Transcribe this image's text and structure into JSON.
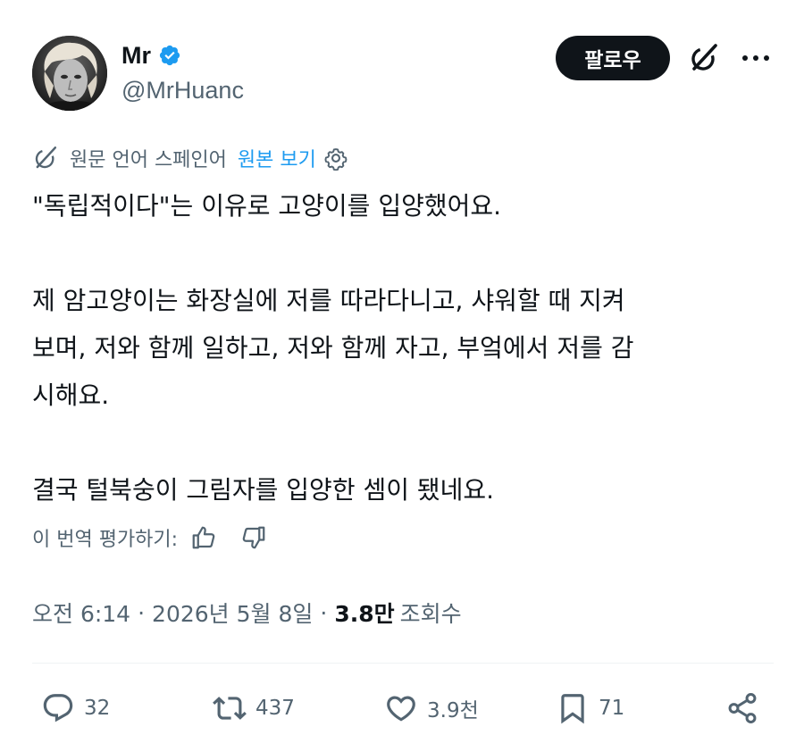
{
  "author": {
    "display_name": "Mr",
    "handle": "@MrHuanc",
    "verified": true,
    "avatar": "avatar-photo"
  },
  "header": {
    "follow_label": "팔로우",
    "grok_icon": "grok-icon",
    "more_icon": "more-icon"
  },
  "translation": {
    "icon": "grok-icon",
    "source_language": "원문 언어 스페인어",
    "show_original": "원본 보기",
    "settings_icon": "gear-icon"
  },
  "tweet": {
    "paragraph_1": "\"독립적이다\"는 이유로 고양이를 입양했어요.",
    "paragraph_2_line_1": "제 암고양이는 화장실에 저를 따라다니고, 샤워할 때 지켜",
    "paragraph_2_line_2": "보며, 저와 함께 일하고, 저와 함께 자고, 부엌에서 저를 감",
    "paragraph_2_line_3": "시해요.",
    "paragraph_3": "결국 털북숭이 그림자를 입양한 셈이 됐네요."
  },
  "rate": {
    "label": "이 번역 평가하기:",
    "thumbs_up_icon": "thumbs-up-icon",
    "thumbs_down_icon": "thumbs-down-icon"
  },
  "meta": {
    "time": "오전 6:14",
    "separator": "·",
    "date": "2026년 5월 8일",
    "views_count": "3.8만",
    "views_label": "조회수"
  },
  "actions": {
    "replies": "32",
    "reposts": "437",
    "likes": "3.9천",
    "bookmarks": "71"
  },
  "colors": {
    "text_primary": "#0f1419",
    "text_secondary": "#536471",
    "accent_blue": "#1d9bf0",
    "follow_bg": "#0f1419",
    "divider": "#eff3f4"
  }
}
